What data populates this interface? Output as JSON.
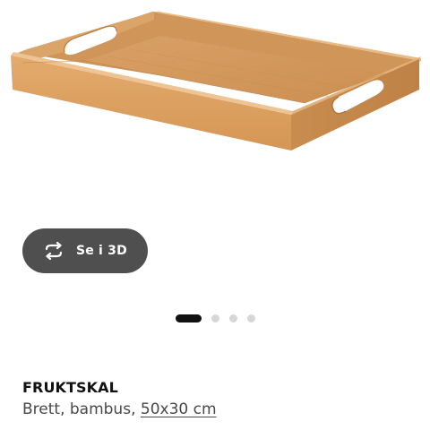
{
  "product": {
    "image_alt": "bamboo serving tray",
    "view_3d_label": "Se i 3D",
    "view_3d_icon": "rotate-arrows-icon",
    "name": "FRUKTSKAL",
    "description_prefix": "Brett, bambus, ",
    "size": "50x30 cm"
  },
  "carousel": {
    "total_images": 4,
    "active_index": 0
  },
  "colors": {
    "button_bg": "#4f4f4f",
    "dot_active": "#111111",
    "dot_inactive": "#d7d7d7"
  }
}
